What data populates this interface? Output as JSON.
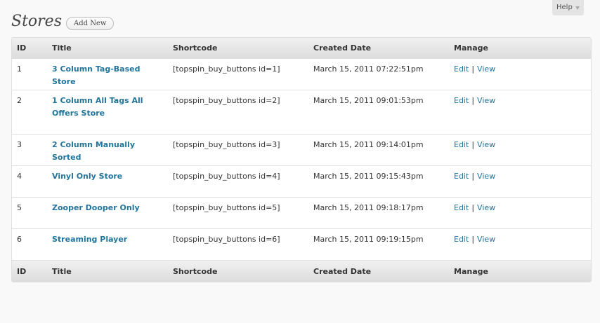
{
  "help": {
    "label": "Help"
  },
  "page": {
    "title": "Stores",
    "add_new_label": "Add New"
  },
  "table": {
    "columns": [
      "ID",
      "Title",
      "Shortcode",
      "Created Date",
      "Manage"
    ],
    "rows": [
      {
        "id": "1",
        "title": "3 Column Tag-Based Store",
        "shortcode": "[topspin_buy_buttons id=1]",
        "created": "March 15, 2011 07:22:51pm",
        "edit": "Edit",
        "sep": "|",
        "view": "View"
      },
      {
        "id": "2",
        "title": "1 Column All Tags All Offers Store",
        "shortcode": "[topspin_buy_buttons id=2]",
        "created": "March 15, 2011 09:01:53pm",
        "edit": "Edit",
        "sep": "|",
        "view": "View"
      },
      {
        "id": "3",
        "title": "2 Column Manually Sorted",
        "shortcode": "[topspin_buy_buttons id=3]",
        "created": "March 15, 2011 09:14:01pm",
        "edit": "Edit",
        "sep": "|",
        "view": "View"
      },
      {
        "id": "4",
        "title": "Vinyl Only Store",
        "shortcode": "[topspin_buy_buttons id=4]",
        "created": "March 15, 2011 09:15:43pm",
        "edit": "Edit",
        "sep": "|",
        "view": "View"
      },
      {
        "id": "5",
        "title": "Zooper Dooper Only",
        "shortcode": "[topspin_buy_buttons id=5]",
        "created": "March 15, 2011 09:18:17pm",
        "edit": "Edit",
        "sep": "|",
        "view": "View"
      },
      {
        "id": "6",
        "title": "Streaming Player",
        "shortcode": "[topspin_buy_buttons id=6]",
        "created": "March 15, 2011 09:19:15pm",
        "edit": "Edit",
        "sep": "|",
        "view": "View"
      }
    ]
  },
  "colors": {
    "link": "#21759b",
    "header_bg": "#dcdcdc",
    "page_bg": "#f9f9f9"
  },
  "icons": {
    "help_caret": "caret-down-icon"
  }
}
